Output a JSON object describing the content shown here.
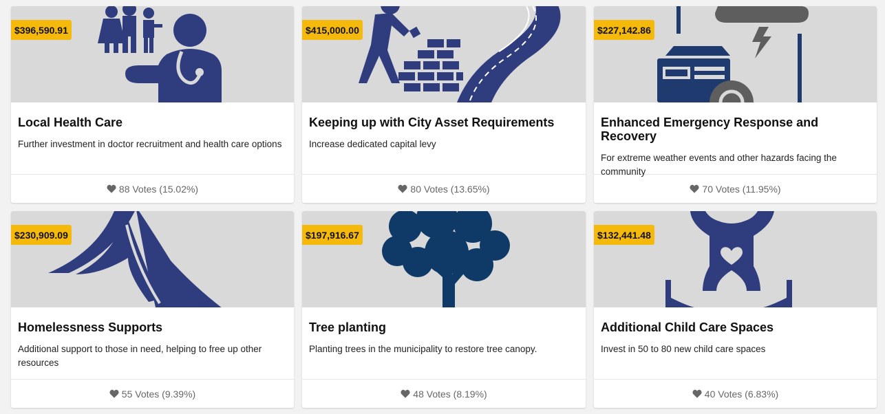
{
  "colors": {
    "price_bg": "#f5b90c",
    "illustration_blue": "#2f3d7e",
    "illustration_dark": "#1e3a6e",
    "media_bg": "#d9d9d9"
  },
  "projects": [
    {
      "price": "$396,590.91",
      "title": "Local Health Care",
      "description": "Further investment in doctor recruitment and health care options",
      "votes": "88 Votes (15.02%)",
      "image_icon": "doctor-family-icon"
    },
    {
      "price": "$415,000.00",
      "title": "Keeping up with City Asset Requirements",
      "description": "Increase dedicated capital levy",
      "votes": "80 Votes (13.65%)",
      "image_icon": "worker-road-icon"
    },
    {
      "price": "$227,142.86",
      "title": "Enhanced Emergency Response and Recovery",
      "description": "For extreme weather events and other hazards facing the community",
      "votes": "70 Votes (11.95%)",
      "image_icon": "storm-emergency-icon"
    },
    {
      "price": "$230,909.09",
      "title": "Homelessness Supports",
      "description": "Additional support to those in need, helping to free up other resources",
      "votes": "55 Votes (9.39%)",
      "image_icon": "tent-icon"
    },
    {
      "price": "$197,916.67",
      "title": "Tree planting",
      "description": "Planting trees in the municipality to restore tree canopy.",
      "votes": "48 Votes (8.19%)",
      "image_icon": "tree-icon"
    },
    {
      "price": "$132,441.48",
      "title": "Additional Child Care Spaces",
      "description": "Invest in 50 to 80 new child care spaces",
      "votes": "40 Votes (6.83%)",
      "image_icon": "child-care-icon"
    }
  ]
}
